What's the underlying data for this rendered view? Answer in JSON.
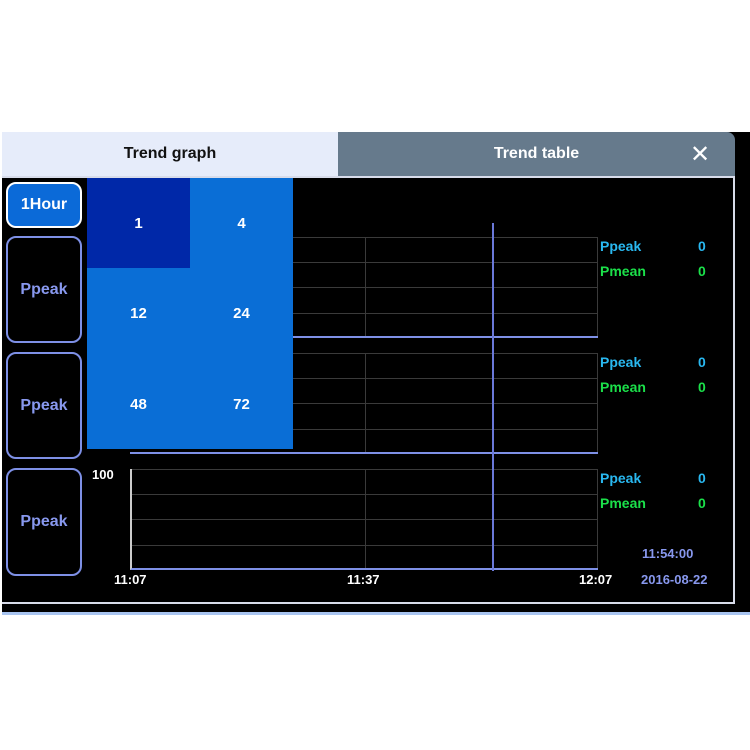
{
  "tabs": [
    {
      "label": "Trend graph",
      "active": true
    },
    {
      "label": "Trend table",
      "active": false
    }
  ],
  "close_icon": "close-icon",
  "left_buttons": {
    "interval": "1Hour",
    "params": [
      "Ppeak",
      "Ppeak",
      "Ppeak"
    ]
  },
  "interval_menu": {
    "options": [
      "1",
      "4",
      "12",
      "24",
      "48",
      "72"
    ],
    "selected": "1"
  },
  "charts": [
    {
      "readouts": [
        {
          "label": "Ppeak",
          "value": "0"
        },
        {
          "label": "Pmean",
          "value": "0"
        }
      ]
    },
    {
      "readouts": [
        {
          "label": "Ppeak",
          "value": "0"
        },
        {
          "label": "Pmean",
          "value": "0"
        }
      ]
    },
    {
      "y_max_label": "100",
      "readouts": [
        {
          "label": "Ppeak",
          "value": "0"
        },
        {
          "label": "Pmean",
          "value": "0"
        }
      ]
    }
  ],
  "x_ticks": [
    "11:07",
    "11:37",
    "12:07"
  ],
  "cursor_time": "11:54:00",
  "date": "2016-08-22",
  "colors": {
    "ppeak": "#29b8f0",
    "pmean": "#1be04a",
    "accent": "#0b6ad8",
    "cursor": "#6a78d8"
  }
}
